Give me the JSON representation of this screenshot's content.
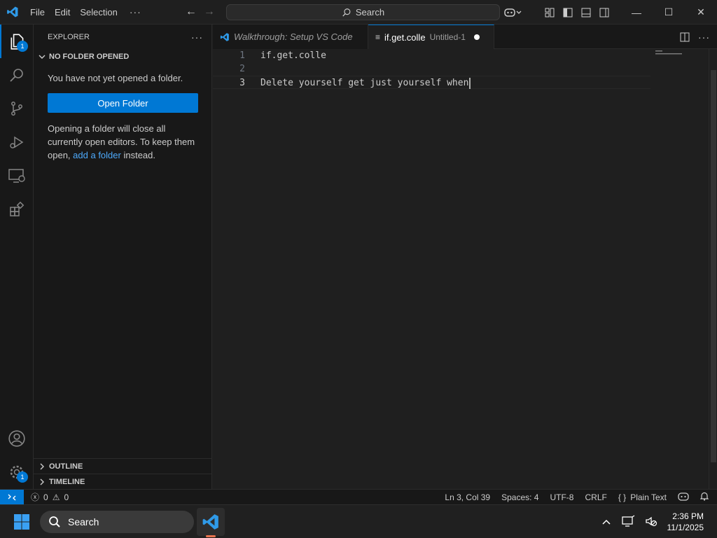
{
  "titlebar": {
    "menu": [
      "File",
      "Edit",
      "Selection"
    ],
    "search_label": "Search"
  },
  "activity_bar": {
    "explorer_badge": "1",
    "manage_badge": "1"
  },
  "sidebar": {
    "header": "EXPLORER",
    "section_title": "NO FOLDER OPENED",
    "no_folder_text": "You have not yet opened a folder.",
    "open_folder_label": "Open Folder",
    "info_text_1": "Opening a folder will close all currently open editors. To keep them open,",
    "info_link": "add a folder",
    "info_text_2": "instead.",
    "outline_label": "OUTLINE",
    "timeline_label": "TIMELINE"
  },
  "tabs": [
    {
      "label": "Walkthrough: Setup VS Code",
      "description": ""
    },
    {
      "label": "if.get.colle",
      "description": "Untitled-1"
    }
  ],
  "editor": {
    "lines": [
      {
        "number": "1",
        "text": "if.get.colle"
      },
      {
        "number": "2",
        "text": ""
      },
      {
        "number": "3",
        "text": "Delete yourself get just yourself when"
      }
    ]
  },
  "statusbar": {
    "errors": "0",
    "warnings": "0",
    "position": "Ln 3, Col 39",
    "spaces": "Spaces: 4",
    "encoding": "UTF-8",
    "eol": "CRLF",
    "language": "Plain Text"
  },
  "taskbar": {
    "search_label": "Search",
    "time": "2:36 PM",
    "date": "11/1/2025"
  },
  "colors": {
    "accent": "#0078d4",
    "editor_bg": "#1f1f1f",
    "sidebar_bg": "#181818"
  }
}
